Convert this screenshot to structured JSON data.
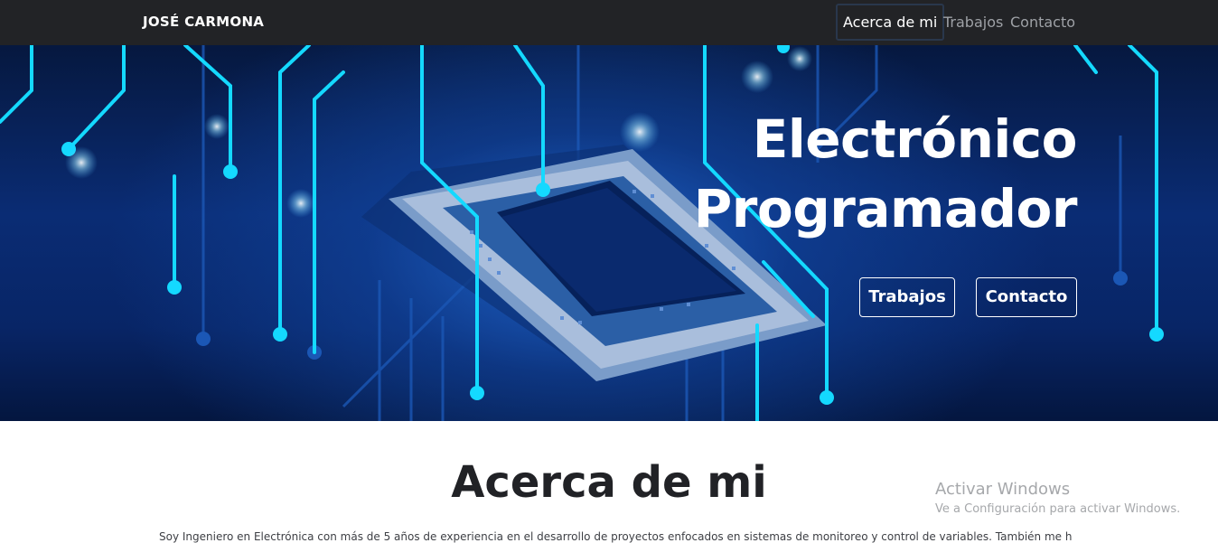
{
  "navbar": {
    "brand": "JOSÉ CARMONA",
    "links": [
      {
        "label": "Acerca de mi",
        "active": true
      },
      {
        "label": "Trabajos",
        "active": false
      },
      {
        "label": "Contacto",
        "active": false
      }
    ]
  },
  "hero": {
    "title_line1": "Electrónico",
    "title_line2": "Programador",
    "buttons": {
      "trabajos": "Trabajos",
      "contacto": "Contacto"
    },
    "accent_color": "#1de0ff"
  },
  "about": {
    "title": "Acerca de mi",
    "text": "Soy Ingeniero en Electrónica con más de 5 años de experiencia en el desarrollo de proyectos enfocados en sistemas de monitoreo y control de variables. También me he"
  },
  "watermark": {
    "title": "Activar Windows",
    "subtitle": "Ve a Configuración para activar Windows."
  }
}
